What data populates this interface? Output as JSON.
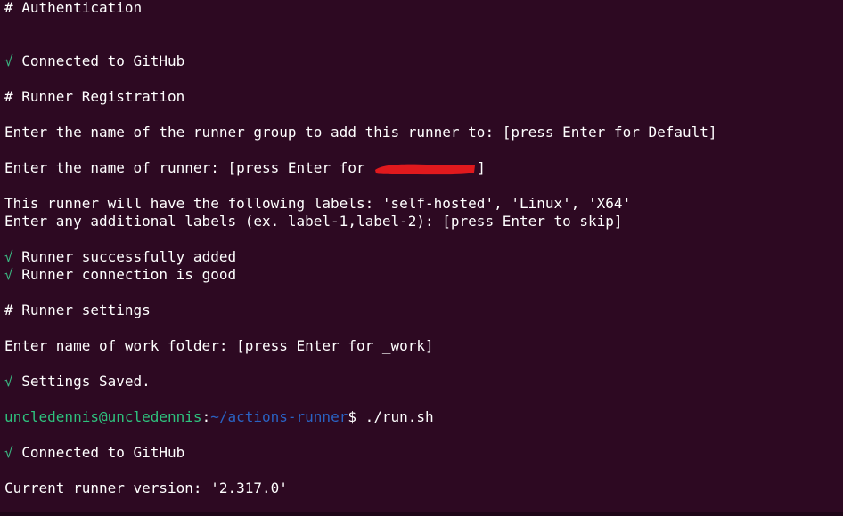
{
  "colors": {
    "background": "#2d0922",
    "text": "#ffffff",
    "check": "#3ab580",
    "prompt_user": "#2ec27e",
    "prompt_path": "#2a63c4",
    "redaction": "#e0191d"
  },
  "lines": {
    "l0": "# Authentication",
    "l3_check": "√",
    "l3_text": " Connected to GitHub",
    "l5": "# Runner Registration",
    "l7": "Enter the name of the runner group to add this runner to: [press Enter for Default]",
    "l9_prefix": "Enter the name of runner: [press Enter for ",
    "l9_suffix": "]",
    "l11": "This runner will have the following labels: 'self-hosted', 'Linux', 'X64'",
    "l12": "Enter any additional labels (ex. label-1,label-2): [press Enter to skip]",
    "l14_check": "√",
    "l14_text": " Runner successfully added",
    "l15_check": "√",
    "l15_text": " Runner connection is good",
    "l17": "# Runner settings",
    "l19": "Enter name of work folder: [press Enter for _work]",
    "l21_check": "√",
    "l21_text": " Settings Saved.",
    "l23_user": "uncledennis@uncledennis",
    "l23_colon": ":",
    "l23_path": "~/actions-runner",
    "l23_cmd": "$ ./run.sh",
    "l25_check": "√",
    "l25_text": " Connected to GitHub",
    "l27": "Current runner version: '2.317.0'"
  }
}
